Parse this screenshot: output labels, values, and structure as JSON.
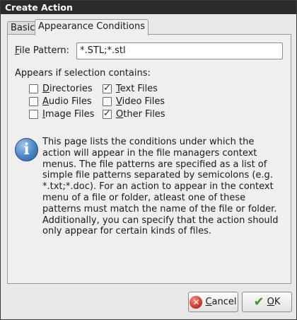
{
  "window": {
    "title": "Create Action"
  },
  "tabs": [
    {
      "label": "Basic"
    },
    {
      "label": "Appearance Conditions"
    }
  ],
  "file_pattern": {
    "label_first": "F",
    "label_rest": "ile Pattern:",
    "value": "*.STL;*.stl"
  },
  "appears_label": "Appears if selection contains:",
  "checkboxes": [
    {
      "u": "D",
      "rest": "irectories",
      "checked": false
    },
    {
      "u": "T",
      "rest": "ext Files",
      "checked": true
    },
    {
      "u": "A",
      "rest": "udio Files",
      "checked": false
    },
    {
      "u": "V",
      "rest": "ideo Files",
      "checked": false
    },
    {
      "u": "I",
      "rest": "mage Files",
      "checked": false
    },
    {
      "u": "O",
      "rest": "ther Files",
      "checked": true
    }
  ],
  "info": {
    "icon": "info-icon",
    "text": "This page lists the conditions under which the action will appear in the file managers context menus. The file patterns are specified as a list of simple file patterns separated by semicolons (e.g. *.txt;*.doc). For an action to appear in the context menu of a file or folder, atleast one of these patterns must match the name of the file or folder. Additionally, you can specify that the action should only appear for certain kinds of files."
  },
  "buttons": {
    "cancel_u": "C",
    "cancel_rest": "ancel",
    "ok_u": "O",
    "ok_rest": "K"
  }
}
